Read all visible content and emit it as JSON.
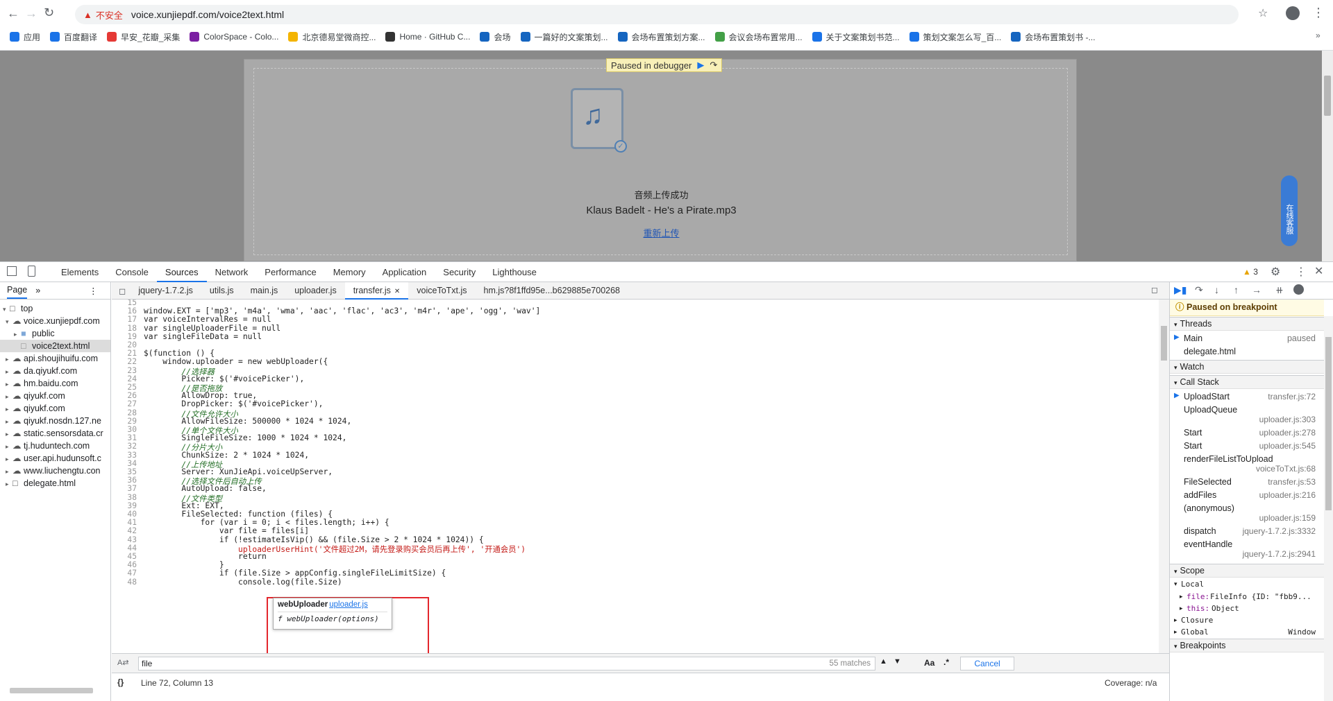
{
  "browser": {
    "security_label": "不安全",
    "url": "voice.xunjiepdf.com/voice2text.html",
    "bookmarks": [
      "应用",
      "百度翻译",
      "早安_花瓣_采集",
      "ColorSpace - Colo...",
      "北京德易堂微商控...",
      "Home · GitHub C...",
      "会场",
      "一篇好的文案策划...",
      "会场布置策划方案...",
      "会议会场布置常用...",
      "关于文案策划书范...",
      "策划文案怎么写_百...",
      "会场布置策划书 -..."
    ],
    "bookmark_colors": [
      "#1a73e8",
      "#1a73e8",
      "#e53935",
      "#7b1fa2",
      "#f4b400",
      "#333333",
      "#1565c0",
      "#1565c0",
      "#1565c0",
      "#43a047",
      "#1a73e8",
      "#1a73e8",
      "#1565c0"
    ]
  },
  "page": {
    "debugger_label": "Paused in debugger",
    "upload_status": "音频上传成功",
    "filename": "Klaus Badelt - He's a Pirate.mp3",
    "reupload_link": "重新上传",
    "side_service": "在线客服"
  },
  "devtools": {
    "tabs": [
      "Elements",
      "Console",
      "Sources",
      "Network",
      "Performance",
      "Memory",
      "Application",
      "Security",
      "Lighthouse"
    ],
    "selected_tab": "Sources",
    "warnings_count": "3",
    "nav": {
      "tab": "Page",
      "items": [
        {
          "label": "top",
          "level": 0
        },
        {
          "label": "voice.xunjiepdf.com",
          "level": 1
        },
        {
          "label": "public",
          "level": 2
        },
        {
          "label": "voice2text.html",
          "level": 2
        },
        {
          "label": "api.shoujihuifu.com",
          "level": 1
        },
        {
          "label": "da.qiyukf.com",
          "level": 1
        },
        {
          "label": "hm.baidu.com",
          "level": 1
        },
        {
          "label": "qiyukf.com",
          "level": 1
        },
        {
          "label": "qiyukf.com",
          "level": 1
        },
        {
          "label": "qiyukf.nosdn.127.ne",
          "level": 1
        },
        {
          "label": "static.sensorsdata.cr",
          "level": 1
        },
        {
          "label": "tj.huduntech.com",
          "level": 1
        },
        {
          "label": "user.api.hudunsoft.c",
          "level": 1
        },
        {
          "label": "www.liuchengtu.con",
          "level": 1
        },
        {
          "label": "delegate.html",
          "level": 1
        }
      ]
    },
    "file_tabs": [
      "jquery-1.7.2.js",
      "utils.js",
      "main.js",
      "uploader.js",
      "transfer.js",
      "voiceToTxt.js",
      "hm.js?8f1ffd95e...b629885e700268"
    ],
    "selected_file": "transfer.js",
    "code_lines": [
      {
        "n": "15",
        "t": ""
      },
      {
        "n": "16",
        "t": "window.EXT = ['mp3', 'm4a', 'wma', 'aac', 'flac', 'ac3', 'm4r', 'ape', 'ogg', 'wav']"
      },
      {
        "n": "17",
        "t": "var voiceIntervalRes = null"
      },
      {
        "n": "18",
        "t": "var singleUploaderFile = null"
      },
      {
        "n": "19",
        "t": "var singleFileData = null"
      },
      {
        "n": "20",
        "t": ""
      },
      {
        "n": "21",
        "t": "$(function () {"
      },
      {
        "n": "22",
        "t": "    window.uploader = new webUploader({"
      },
      {
        "n": "23",
        "t": "        //选择器"
      },
      {
        "n": "24",
        "t": "        Picker: $('#voicePicker'),"
      },
      {
        "n": "25",
        "t": "        //是否拖放"
      },
      {
        "n": "26",
        "t": "        AllowDrop: true,"
      },
      {
        "n": "27",
        "t": "        DropPicker: $('#voicePicker'),"
      },
      {
        "n": "28",
        "t": "        //文件允许大小"
      },
      {
        "n": "29",
        "t": "        AllowFileSize: 500000 * 1024 * 1024,"
      },
      {
        "n": "30",
        "t": "        //单个文件大小"
      },
      {
        "n": "31",
        "t": "        SingleFileSize: 1000 * 1024 * 1024,"
      },
      {
        "n": "32",
        "t": "        //分片大小"
      },
      {
        "n": "33",
        "t": "        ChunkSize: 2 * 1024 * 1024,"
      },
      {
        "n": "34",
        "t": "        //上传地址"
      },
      {
        "n": "35",
        "t": "        Server: XunJieApi.voiceUpServer,"
      },
      {
        "n": "36",
        "t": "        //选择文件后自动上传"
      },
      {
        "n": "37",
        "t": "        AutoUpload: false,"
      },
      {
        "n": "38",
        "t": "        //文件类型"
      },
      {
        "n": "39",
        "t": "        Ext: EXT,"
      },
      {
        "n": "40",
        "t": "        FileSelected: function (files) {"
      },
      {
        "n": "41",
        "t": "            for (var i = 0; i < files.length; i++) {"
      },
      {
        "n": "42",
        "t": "                var file = files[i]"
      },
      {
        "n": "43",
        "t": "                if (!estimateIsVip() && (file.Size > 2 * 1024 * 1024)) {"
      },
      {
        "n": "44",
        "t": "                    uploaderUserHint('文件超过2M，请先登录购买会员后再上传', '开通会员')"
      },
      {
        "n": "45",
        "t": "                    return"
      },
      {
        "n": "46",
        "t": "                }"
      },
      {
        "n": "47",
        "t": "                if (file.Size > appConfig.singleFileLimitSize) {"
      },
      {
        "n": "48",
        "t": "                    console.log(file.Size)"
      }
    ],
    "tooltip": {
      "name": "webUploader",
      "link": "uploader.js",
      "signature": "f webUploader(options)"
    },
    "search": {
      "query": "file",
      "matches": "55 matches",
      "case_label": "Aa",
      "regex_label": ".*",
      "cancel": "Cancel"
    },
    "status": {
      "position": "Line 72, Column 13",
      "coverage": "Coverage: n/a"
    },
    "right": {
      "paused_label": "Paused on breakpoint",
      "threads_label": "Threads",
      "threads": [
        {
          "name": "Main",
          "state": "paused"
        },
        {
          "name": "delegate.html",
          "state": ""
        }
      ],
      "watch_label": "Watch",
      "callstack_label": "Call Stack",
      "callstack": [
        {
          "fn": "UploadStart",
          "loc": "transfer.js:72"
        },
        {
          "fn": "UploadQueue",
          "loc": "uploader.js:303"
        },
        {
          "fn": "Start",
          "loc": "uploader.js:278"
        },
        {
          "fn": "Start",
          "loc": "uploader.js:545"
        },
        {
          "fn": "renderFileListToUpload",
          "loc": "voiceToTxt.js:68"
        },
        {
          "fn": "FileSelected",
          "loc": "transfer.js:53"
        },
        {
          "fn": "addFiles",
          "loc": "uploader.js:216"
        },
        {
          "fn": "(anonymous)",
          "loc": "uploader.js:159"
        },
        {
          "fn": "dispatch",
          "loc": "jquery-1.7.2.js:3332"
        },
        {
          "fn": "eventHandle",
          "loc": "jquery-1.7.2.js:2941"
        }
      ],
      "scope_label": "Scope",
      "local_label": "Local",
      "scope_vars": [
        {
          "name": "file:",
          "val": "FileInfo {ID: \"fbb9..."
        },
        {
          "name": "this:",
          "val": "Object"
        }
      ],
      "closure_label": "Closure",
      "global_label": "Global",
      "global_val": "Window",
      "breakpoints_label": "Breakpoints"
    }
  }
}
